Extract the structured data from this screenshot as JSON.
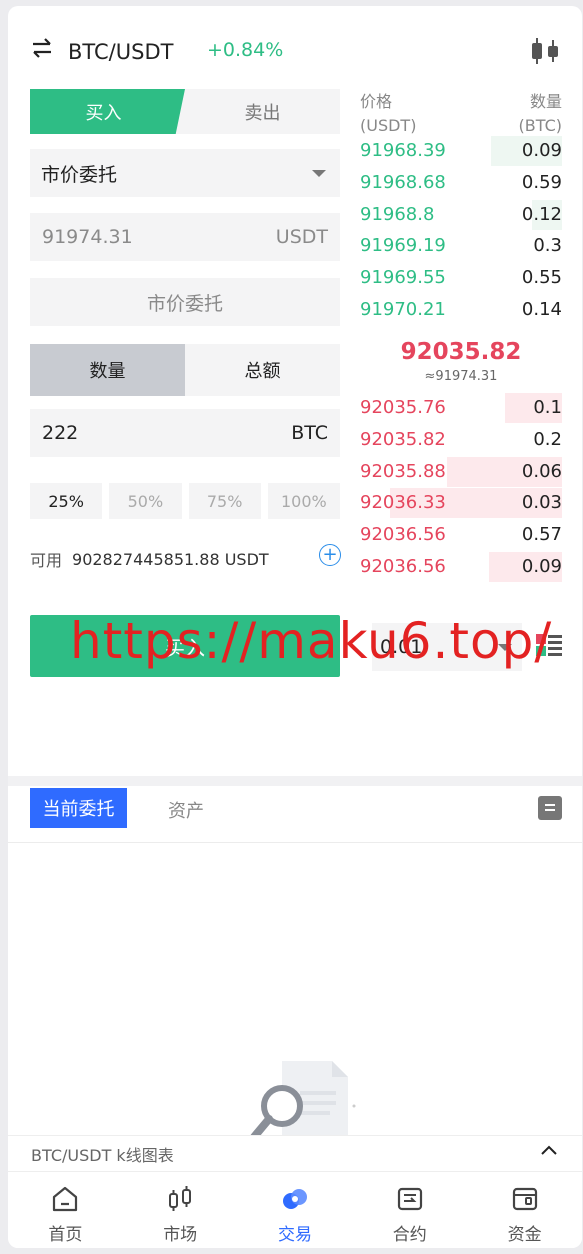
{
  "header": {
    "pair": "BTC/USDT",
    "change": "+0.84%"
  },
  "trade": {
    "buy_tab": "买入",
    "sell_tab": "卖出",
    "order_type": "市价委托",
    "price_value": "91974.31",
    "price_unit": "USDT",
    "market_label": "市价委托",
    "mode_qty": "数量",
    "mode_total": "总额",
    "qty_value": "222",
    "qty_unit": "BTC",
    "pct": [
      "25%",
      "50%",
      "75%",
      "100%"
    ],
    "available_label": "可用",
    "available_value": "902827445851.88 USDT",
    "buy_button": "买入",
    "depth_value": "0.01"
  },
  "watermark": "https://maku6.top/",
  "orderbook": {
    "price_header": "价格",
    "price_unit": "(USDT)",
    "qty_header": "数量",
    "qty_unit": "(BTC)",
    "bids": [
      {
        "price": "91968.39",
        "qty": "0.09",
        "depth": 0.35
      },
      {
        "price": "91968.68",
        "qty": "0.59",
        "depth": 0.0
      },
      {
        "price": "91968.8",
        "qty": "0.12",
        "depth": 0.15
      },
      {
        "price": "91969.19",
        "qty": "0.3",
        "depth": 0.0
      },
      {
        "price": "91969.55",
        "qty": "0.55",
        "depth": 0.0
      },
      {
        "price": "91970.21",
        "qty": "0.14",
        "depth": 0.0
      }
    ],
    "last_price": "92035.82",
    "last_price_ref": "≈91974.31",
    "asks": [
      {
        "price": "92035.76",
        "qty": "0.1",
        "depth": 0.28
      },
      {
        "price": "92035.82",
        "qty": "0.2",
        "depth": 0.0
      },
      {
        "price": "92035.88",
        "qty": "0.06",
        "depth": 0.57
      },
      {
        "price": "92036.33",
        "qty": "0.03",
        "depth": 0.85
      },
      {
        "price": "92036.56",
        "qty": "0.57",
        "depth": 0.0
      },
      {
        "price": "92036.56",
        "qty": "0.09",
        "depth": 0.36
      }
    ]
  },
  "orders": {
    "tab_current": "当前委托",
    "tab_assets": "资产"
  },
  "kline": {
    "label": "BTC/USDT k线图表"
  },
  "nav": [
    {
      "label": "首页",
      "icon": "home-icon"
    },
    {
      "label": "市场",
      "icon": "market-icon"
    },
    {
      "label": "交易",
      "icon": "trade-icon"
    },
    {
      "label": "合约",
      "icon": "contract-icon"
    },
    {
      "label": "资金",
      "icon": "wallet-icon"
    }
  ],
  "colors": {
    "green": "#2ebd85",
    "red": "#e5455d",
    "blue": "#2f6bff"
  }
}
